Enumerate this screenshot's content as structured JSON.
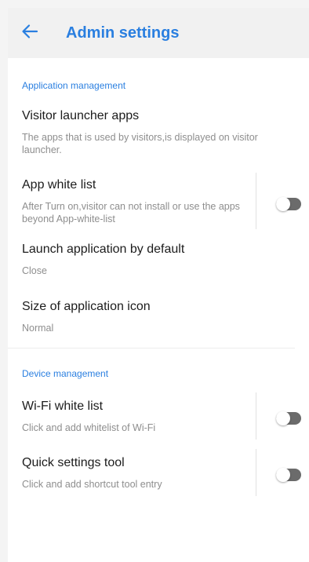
{
  "header": {
    "title": "Admin settings",
    "back_icon": "arrow-left-icon",
    "accent_color": "#2a7fe0"
  },
  "sections": [
    {
      "label": "Application management",
      "items": [
        {
          "title": "Visitor launcher apps",
          "subtitle": "The apps that is used by visitors,is displayed on visitor launcher."
        },
        {
          "title": "App white list",
          "subtitle": "After Turn on,visitor can not install or use the apps beyond App-white-list",
          "toggle": false
        },
        {
          "title": "Launch application by default",
          "subtitle": "Close"
        },
        {
          "title": "Size of application icon",
          "subtitle": "Normal"
        }
      ]
    },
    {
      "label": "Device management",
      "items": [
        {
          "title": "Wi-Fi white list",
          "subtitle": "Click and add whitelist of Wi-Fi",
          "toggle": false
        },
        {
          "title": "Quick settings tool",
          "subtitle": "Click and add shortcut tool entry",
          "toggle": false
        }
      ]
    }
  ]
}
